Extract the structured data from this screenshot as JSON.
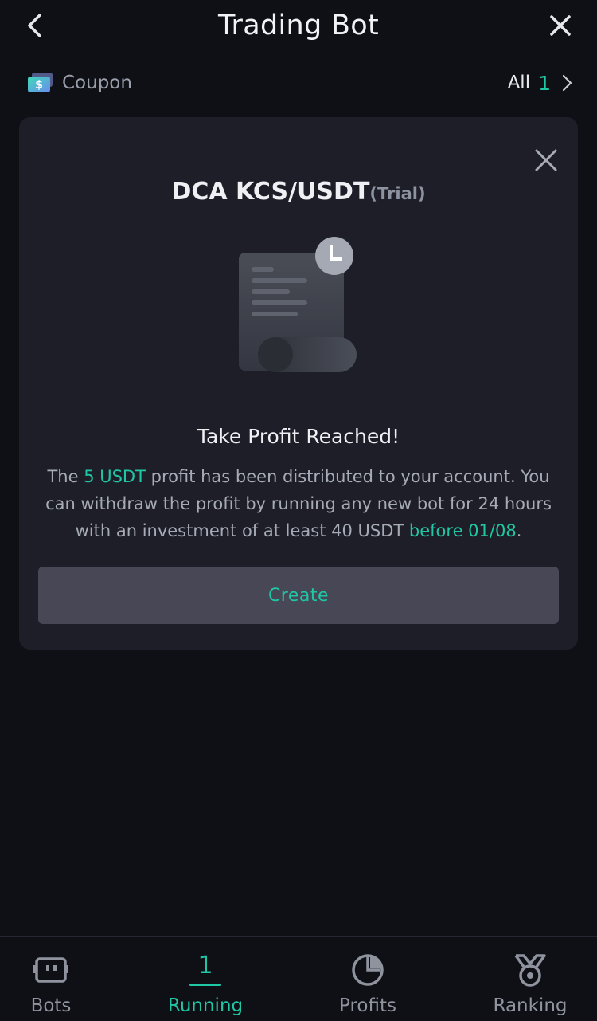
{
  "header": {
    "title": "Trading Bot"
  },
  "coupon": {
    "label": "Coupon",
    "all_label": "All",
    "all_count": "1"
  },
  "card": {
    "pair": "DCA KCS/USDT",
    "tag": "(Trial)",
    "heading": "Take Profit Reached!",
    "desc_part1": "The ",
    "desc_amount": "5 USDT",
    "desc_part2": " profit has been distributed to your account. You can withdraw the profit by running any new bot for 24 hours with an investment of at least 40 USDT ",
    "desc_deadline": "before 01/08",
    "desc_part3": ".",
    "create_label": "Create"
  },
  "nav": {
    "bots_label": "Bots",
    "running_label": "Running",
    "running_count": "1",
    "profits_label": "Profits",
    "ranking_label": "Ranking"
  },
  "colors": {
    "accent": "#1fc7a4",
    "background": "#0f0f16",
    "card": "#1e1e28",
    "button": "#474756"
  },
  "icons": [
    "chevron-left-icon",
    "close-icon",
    "coupon-ticket-icon",
    "chevron-right-icon",
    "receipt-clock-icon",
    "bot-icon",
    "pie-chart-icon",
    "medal-icon"
  ]
}
